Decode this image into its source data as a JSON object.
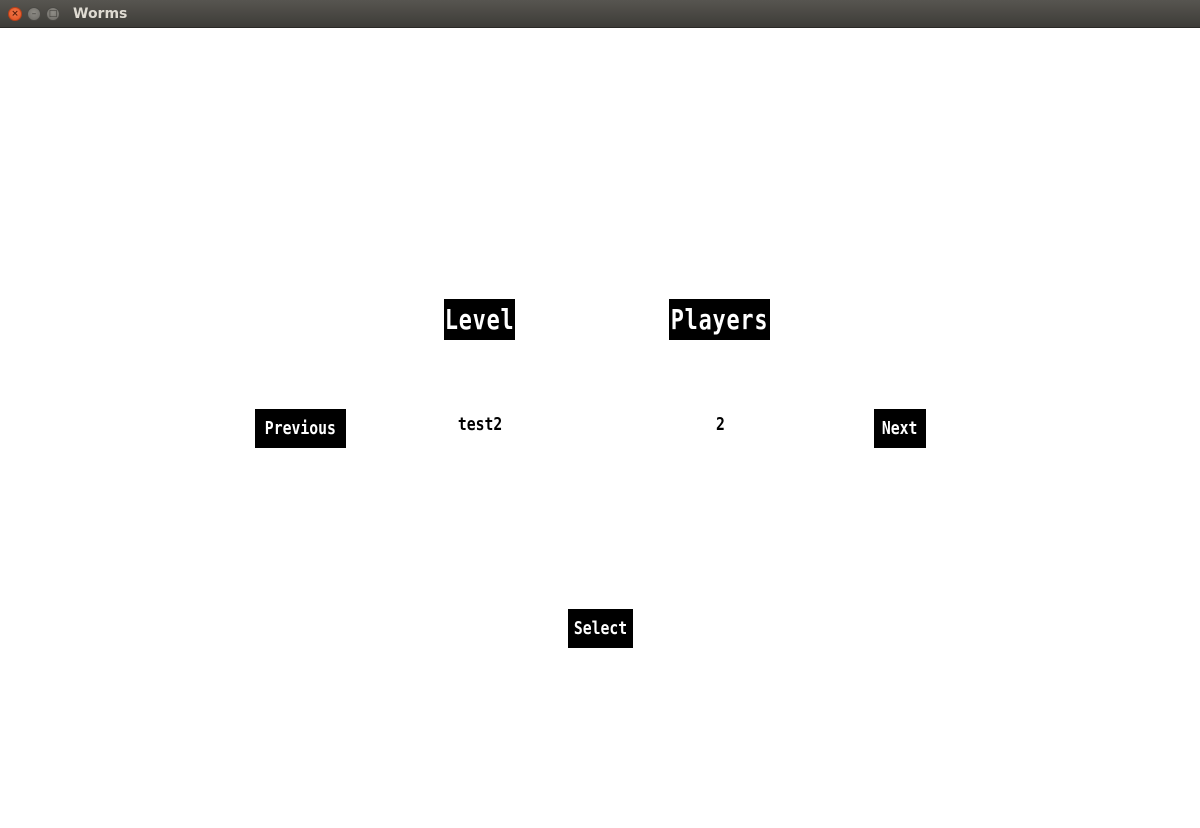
{
  "window": {
    "title": "Worms",
    "close_glyph": "×",
    "minimize_glyph": "–",
    "maximize_glyph": "□"
  },
  "menu": {
    "level_heading": "Level",
    "players_heading": "Players",
    "previous_label": "Previous",
    "next_label": "Next",
    "select_label": "Select",
    "level_value": "test2",
    "players_value": "2"
  },
  "colors": {
    "background": "#ffffff",
    "label_background": "#000000",
    "label_text": "#ffffff",
    "value_text": "#000000",
    "titlebar": "#3d3c38",
    "close_button": "#e0501f"
  }
}
